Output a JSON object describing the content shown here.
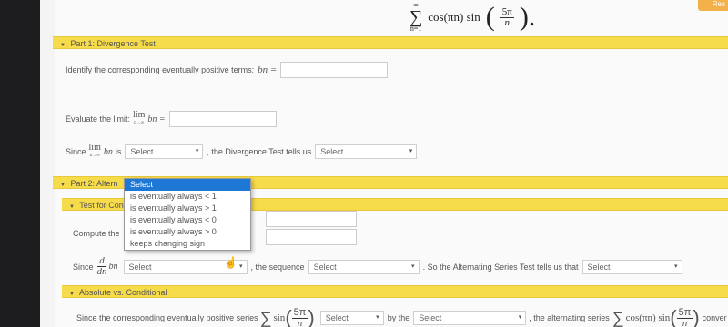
{
  "header": {
    "series_sum_sub": "n=1",
    "series_sum_sup": "∞",
    "series_term": "cos(πn) sin",
    "series_frac_num": "5π",
    "series_frac_den": "n",
    "reset_label": "Res"
  },
  "part1": {
    "title": "Part 1: Divergence Test",
    "identify_label": "Identify the corresponding eventually positive terms:",
    "bn_symbol": "bn =",
    "evaluate_label": "Evaluate the limit:",
    "lim_word": "lim",
    "lim_sub": "n→∞",
    "lim_bn": "bn =",
    "since_label": "Since",
    "since_bn": "bn",
    "is_label": "is",
    "select1_value": "Select",
    "divergence_label": ", the Divergence Test tells us",
    "select2_value": "Select"
  },
  "part2": {
    "title": "Part 2: Altern",
    "subsection_title": "Test for Con",
    "compute_label": "Compute the",
    "since_label": "Since",
    "deriv_num": "d",
    "deriv_den": "dn",
    "deriv_bn": "bn",
    "select3_value": "Select",
    "sequence_label": ", the sequence",
    "select4_value": "Select",
    "ast_label": ". So the Alternating Series Test tells us that",
    "select5_value": "Select"
  },
  "dropdown": {
    "options": [
      "Select",
      "is eventually always < 1",
      "is eventually always > 1",
      "is eventually always < 0",
      "is eventually always > 0",
      "keeps changing sign"
    ],
    "selected_index": 0
  },
  "abs_section": {
    "title": "Absolute vs. Conditional",
    "since_label": "Since the corresponding eventually positive series",
    "term": "sin",
    "frac_num": "5π",
    "frac_den": "n",
    "select6_value": "Select",
    "by_label": "by the",
    "select7_value": "Select",
    "alt_label": ", the alternating series",
    "alt_term": "cos(πn) sin",
    "alt_frac_num": "5π",
    "alt_frac_den": "n",
    "converges_label": "conver"
  }
}
